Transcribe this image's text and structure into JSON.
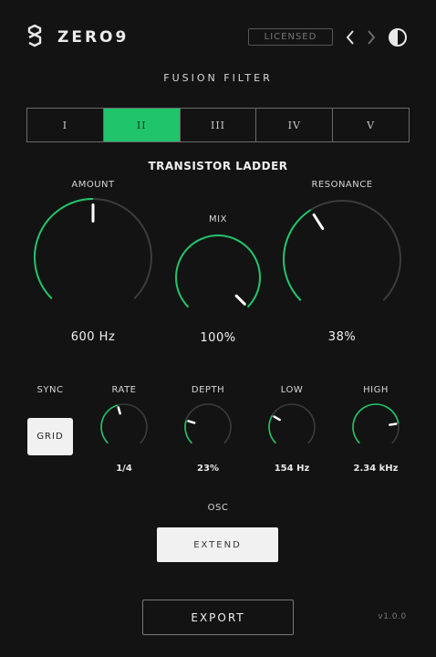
{
  "header": {
    "brand": "ZERO9",
    "license_label": "LICENSED"
  },
  "section_title": "FUSION FILTER",
  "filter_modes": [
    {
      "label": "I",
      "active": false
    },
    {
      "label": "II",
      "active": true
    },
    {
      "label": "III",
      "active": false
    },
    {
      "label": "IV",
      "active": false
    },
    {
      "label": "V",
      "active": false
    }
  ],
  "filter_type": "TRANSISTOR LADDER",
  "main_knobs": {
    "amount": {
      "label": "AMOUNT",
      "value": "600 Hz",
      "level": 0.5
    },
    "mix": {
      "label": "MIX",
      "value": "100%",
      "level": 1.0
    },
    "resonance": {
      "label": "RESONANCE",
      "value": "38%",
      "level": 0.38
    }
  },
  "modulation": {
    "sync": {
      "label": "SYNC",
      "button": "GRID"
    },
    "rate": {
      "label": "RATE",
      "value": "1/4",
      "level": 0.44
    },
    "depth": {
      "label": "DEPTH",
      "value": "23%",
      "level": 0.23
    },
    "low": {
      "label": "LOW",
      "value": "154 Hz",
      "level": 0.28
    },
    "high": {
      "label": "HIGH",
      "value": "2.34 kHz",
      "level": 0.8
    }
  },
  "osc": {
    "label": "OSC",
    "button": "EXTEND"
  },
  "footer": {
    "export_label": "EXPORT",
    "version": "v1.0.0"
  },
  "colors": {
    "accent": "#20c46b",
    "track": "#3c3c3c",
    "background": "#131313"
  }
}
